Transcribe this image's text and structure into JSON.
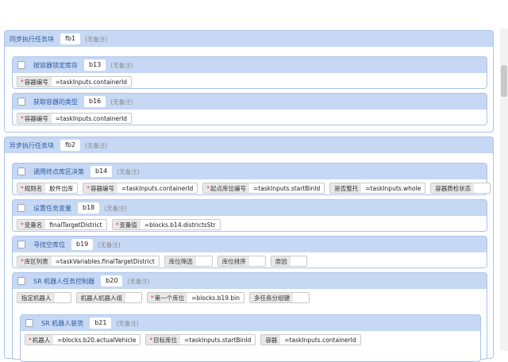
{
  "fb1": {
    "title": "同步执行任务块",
    "tag": "fb1",
    "note": "(无备注)",
    "b13": {
      "title": "按容器锁定库存",
      "tag": "b13",
      "note": "(无备注)",
      "fields": [
        {
          "label": "容器编号",
          "required": "*",
          "value": "=taskInputs.containerId"
        }
      ]
    },
    "b16": {
      "title": "获取容器的类型",
      "tag": "b16",
      "note": "(无备注)",
      "fields": [
        {
          "label": "容器编号",
          "required": "*",
          "value": "=taskInputs.containerId"
        }
      ]
    }
  },
  "fb2": {
    "title": "异步执行任务块",
    "tag": "fb2",
    "note": "(无备注)",
    "b14": {
      "title": "调用终点库区决策",
      "tag": "b14",
      "note": "(无备注)",
      "fields": [
        {
          "label": "规则名",
          "required": "*",
          "value": "胶件出库"
        },
        {
          "label": "容器编号",
          "required": "*",
          "value": "=taskInputs.containerId"
        },
        {
          "label": "起点库位编号",
          "required": "*",
          "value": "=taskInputs.startBinId"
        },
        {
          "label": "是否整托",
          "required": "",
          "value": "=taskInputs.whole"
        },
        {
          "label": "容器质检状态",
          "required": "",
          "value": ""
        }
      ]
    },
    "b18": {
      "title": "设置任务变量",
      "tag": "b18",
      "note": "(无备注)",
      "fields": [
        {
          "label": "变量名",
          "required": "*",
          "value": "finalTargetDistrict"
        },
        {
          "label": "变量值",
          "required": "*",
          "value": "=blocks.b14.districtsStr"
        }
      ]
    },
    "b19": {
      "title": "寻找空库位",
      "tag": "b19",
      "note": "(无备注)",
      "fields": [
        {
          "label": "库区列表",
          "required": "*",
          "value": "=taskVariables.finalTargetDistrict"
        },
        {
          "label": "库位筛选",
          "required": "",
          "value": ""
        },
        {
          "label": "库位排序",
          "required": "",
          "value": ""
        },
        {
          "label": "原因",
          "required": "",
          "value": ""
        }
      ]
    },
    "b20": {
      "title": "SR 机器人任务控制器",
      "tag": "b20",
      "note": "(无备注)",
      "fields": [
        {
          "label": "指定机器人",
          "required": "",
          "value": ""
        },
        {
          "label": "机器人机器人组",
          "required": "",
          "value": ""
        },
        {
          "label": "第一个库位",
          "required": "*",
          "value": "=blocks.b19.bin"
        },
        {
          "label": "多任务分组键",
          "required": "",
          "value": ""
        }
      ],
      "b21": {
        "title": "SR 机器人装货",
        "tag": "b21",
        "note": "(无备注)",
        "fields": [
          {
            "label": "机器人",
            "required": "*",
            "value": "=blocks.b20.actualVehicle"
          },
          {
            "label": "目标库位",
            "required": "*",
            "value": "=taskInputs.startBinId"
          },
          {
            "label": "容器",
            "required": "",
            "value": "=taskInputs.containerId"
          }
        ]
      }
    }
  }
}
